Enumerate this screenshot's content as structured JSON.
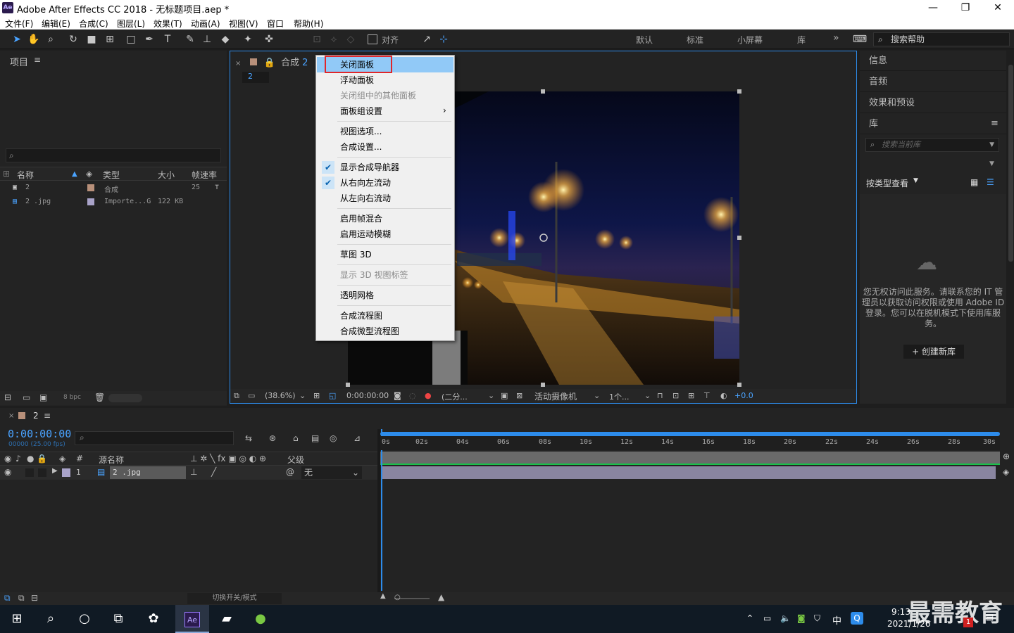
{
  "app": {
    "title": "Adobe After Effects CC 2018 - 无标题项目.aep *",
    "logo": "Ae"
  },
  "window_controls": {
    "minimize": "—",
    "maximize": "❐",
    "close": "✕"
  },
  "menu": [
    "文件(F)",
    "编辑(E)",
    "合成(C)",
    "图层(L)",
    "效果(T)",
    "动画(A)",
    "视图(V)",
    "窗口",
    "帮助(H)"
  ],
  "toolbar": {
    "snap_label": "对齐",
    "workspaces": [
      "默认",
      "标准",
      "小屏幕",
      "库"
    ],
    "more": "»",
    "search_help_placeholder": "搜索帮助"
  },
  "project": {
    "title": "项目",
    "columns": [
      "名称",
      "类型",
      "大小",
      "帧速率"
    ],
    "rows": [
      {
        "name": "2",
        "type": "合成",
        "size": "",
        "fps": "25",
        "swatch": "#b8907a"
      },
      {
        "name": "2 .jpg",
        "type": "Importe...G",
        "size": "122 KB",
        "fps": "",
        "swatch": "#a9a3c9"
      }
    ],
    "bpc": "8 bpc"
  },
  "composition": {
    "tab_label": "合成",
    "tab_name": "2",
    "breadcrumb": "2",
    "zoom": "(38.6%)",
    "timecode": "0:00:00:00",
    "resolution": "(二分...",
    "camera": "活动摄像机",
    "views": "1个...",
    "exposure": "+0.0"
  },
  "context_menu": {
    "items": [
      {
        "label": "关闭面板",
        "state": "highlighted"
      },
      {
        "label": "浮动面板",
        "state": "normal"
      },
      {
        "label": "关闭组中的其他面板",
        "state": "disabled"
      },
      {
        "label": "面板组设置",
        "state": "submenu"
      },
      {
        "label": "视图选项...",
        "state": "normal"
      },
      {
        "label": "合成设置...",
        "state": "normal"
      },
      {
        "label": "显示合成导航器",
        "state": "checked"
      },
      {
        "label": "从右向左流动",
        "state": "checked"
      },
      {
        "label": "从左向右流动",
        "state": "normal"
      },
      {
        "label": "启用帧混合",
        "state": "normal"
      },
      {
        "label": "启用运动模糊",
        "state": "normal"
      },
      {
        "label": "草图 3D",
        "state": "normal"
      },
      {
        "label": "显示 3D 视图标签",
        "state": "disabled"
      },
      {
        "label": "透明网格",
        "state": "normal"
      },
      {
        "label": "合成流程图",
        "state": "normal"
      },
      {
        "label": "合成微型流程图",
        "state": "normal"
      }
    ]
  },
  "right_panel": {
    "items": [
      "信息",
      "音频",
      "效果和预设",
      "库"
    ],
    "library_search_placeholder": "搜索当前库",
    "view_by": "按类型查看",
    "message": "您无权访问此服务。请联系您的 IT 管理员以获取访问权限或使用 Adobe ID 登录。您可以在脱机模式下使用库服务。",
    "create_button": "+ 创建新库"
  },
  "timeline": {
    "comp_tab": "2",
    "timecode": "0:00:00:00",
    "timecode_sub": "00000 (25.00 fps)",
    "col_num": "#",
    "col_source": "源名称",
    "col_parent": "父级",
    "layer": {
      "index": "1",
      "name": "2 .jpg",
      "parent": "无"
    },
    "ruler_ticks": [
      "0s",
      "02s",
      "04s",
      "06s",
      "08s",
      "10s",
      "12s",
      "14s",
      "16s",
      "18s",
      "20s",
      "22s",
      "24s",
      "26s",
      "28s",
      "30s"
    ],
    "toggle_label": "切换开关/模式"
  },
  "taskbar": {
    "time": "9:13",
    "date": "2021/1/26",
    "ime": "中",
    "watermark": "最需教育",
    "notif_count": "1"
  },
  "colors": {
    "accent_blue": "#2d8ceb",
    "highlight": "#91c9f7",
    "red_box": "#e0262a",
    "layer_bar": "#9b96b6"
  }
}
